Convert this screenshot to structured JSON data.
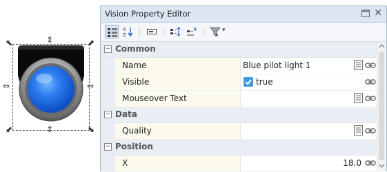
{
  "panel": {
    "title": "Vision Property Editor",
    "close_glyph": "✕"
  },
  "toolbar": {
    "buttons": [
      {
        "name": "categorized-view-icon",
        "active": true
      },
      {
        "name": "sort-alphabetical-icon",
        "active": false
      },
      {
        "name": "text-field-icon",
        "active": false
      },
      {
        "name": "expand-all-icon",
        "active": false
      },
      {
        "name": "collapse-all-icon",
        "active": false
      },
      {
        "name": "filter-icon",
        "active": false
      }
    ],
    "dropdown_glyph": "▾"
  },
  "categories": [
    {
      "label": "Common",
      "toggle": "−",
      "properties": [
        {
          "name": "Name",
          "value": "Blue pilot light 1",
          "has_doc": true,
          "has_link": true
        },
        {
          "name": "Visible",
          "value": "true",
          "type": "checkbox",
          "checked": true,
          "has_doc": false,
          "has_link": true
        },
        {
          "name": "Mouseover Text",
          "value": "",
          "has_doc": true,
          "has_link": true
        }
      ]
    },
    {
      "label": "Data",
      "toggle": "−",
      "properties": [
        {
          "name": "Quality",
          "value": "",
          "has_doc": true,
          "has_link": true
        }
      ]
    },
    {
      "label": "Position",
      "toggle": "−",
      "properties": [
        {
          "name": "X",
          "value": "18.0",
          "align": "right",
          "has_doc": false,
          "has_link": true
        }
      ]
    }
  ],
  "component": {
    "name": "pilot-light",
    "lens_color": "#1e6fe8",
    "housing_color": "#0a0a0a",
    "bezel_color": "#9a9a9a"
  },
  "colors": {
    "titlebar": "#dce6f2",
    "category_bg": "#e9eef5",
    "name_col_bg": "#fbfaec",
    "checkbox": "#3f97e4"
  }
}
